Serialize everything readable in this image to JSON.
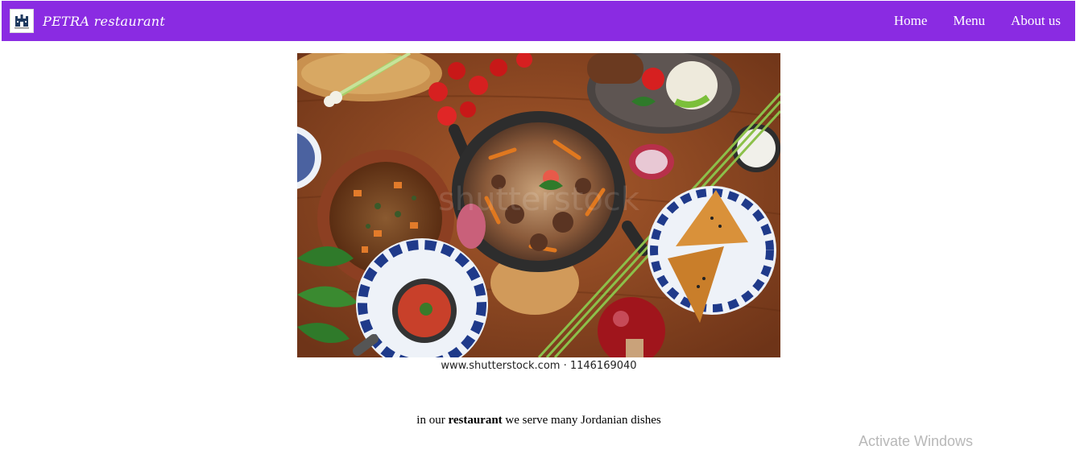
{
  "header": {
    "brand_name": "PETRA restaurant",
    "logo_icon": "castle-icon",
    "nav": [
      {
        "label": "Home"
      },
      {
        "label": "Menu"
      },
      {
        "label": "About us"
      }
    ],
    "background_color": "#8a2be2"
  },
  "hero": {
    "image_subject": "overhead view of many dishes on a wooden table",
    "caption": "www.shutterstock.com · 1146169040"
  },
  "intro": {
    "prefix": "in our",
    "emphasis": "restaurant",
    "suffix": "we serve many Jordanian dishes"
  },
  "os_overlay": {
    "text": "Activate Windows"
  }
}
